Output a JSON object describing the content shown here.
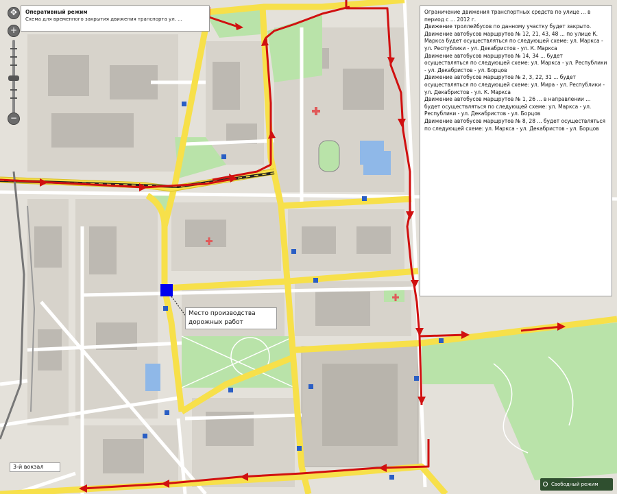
{
  "info_panel": {
    "title": "Оперативный режим",
    "subtitle": "Схема для временного закрытия движения транспорта ул. ..."
  },
  "description": [
    "Ограничение движения транспортных средств по улице ... в период с ... 2012 г.",
    "Движение троллейбусов по данному участку будет закрыто.",
    "Движение автобусов маршрутов № 12, 21, 43, 48 ... по улице К. Маркса будет осуществляться по следующей схеме: ул. Маркса - ул. Республики - ул. Декабристов - ул. К. Маркса",
    "Движение автобусов маршрутов № 14, 34 ... будет осуществляться по следующей схеме: ул. Маркса - ул. Республики - ул. Декабристов - ул. Борцов",
    "Движение автобусов маршрутов № 2, 3, 22, 31 ... будет осуществляться по следующей схеме: ул. Мира - ул. Республики - ул. Декабристов - ул. К. Маркса",
    "Движение автобусов маршрутов № 1, 26 ... в направлении ... будет осуществляться по следующей схеме: ул. Маркса - ул. Республики - ул. Декабристов - ул. Борцов",
    "Движение автобусов маршрутов № 8, 28 ... будет осуществляться по следующей схеме: ул. Маркса - ул. Декабристов - ул. Борцов"
  ],
  "labels": {
    "work_place": "Место производства дорожных работ",
    "corner": "3-й вокзал",
    "search_button": "Свободный режим"
  },
  "zoom": {
    "plus": "+",
    "minus": "−"
  },
  "colors": {
    "background": "#e4e1da",
    "block": "#d7d3cb",
    "building": "#bdb9b2",
    "park": "#b9e3a9",
    "water": "#8fb8e8",
    "major_road": "#f7e04a",
    "minor_road": "#ffffff",
    "railway": "#222222",
    "detour_route": "#d01010",
    "work_marker": "#0000ee"
  }
}
